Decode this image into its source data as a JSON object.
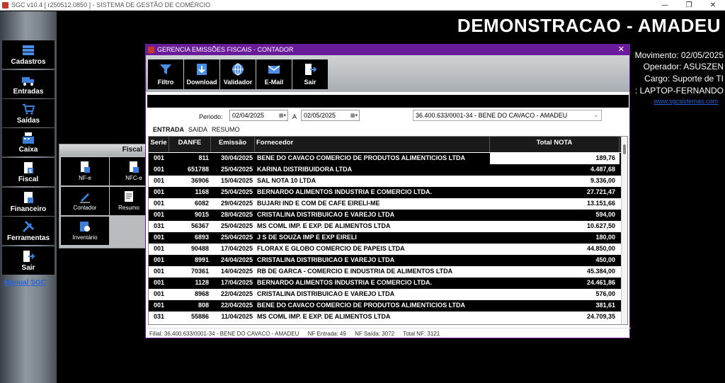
{
  "window": {
    "title": "SGC v10.4 [ r250512.0850 ] - SISTEMA DE GESTÃO DE COMÉRCIO",
    "minimize": "—",
    "maximize": "❐",
    "close": "✕"
  },
  "sidebar": {
    "items": [
      {
        "label": "Cadastros",
        "icon": "stack-icon"
      },
      {
        "label": "Entradas",
        "icon": "truck-icon"
      },
      {
        "label": "Saídas",
        "icon": "cart-icon"
      },
      {
        "label": "Caixa",
        "icon": "cash-register-icon"
      },
      {
        "label": "Fiscal",
        "icon": "fiscal-document-icon"
      },
      {
        "label": "Financeiro",
        "icon": "finance-document-icon"
      },
      {
        "label": "Ferramentas",
        "icon": "tools-icon"
      },
      {
        "label": "Sair",
        "icon": "exit-door-icon"
      }
    ],
    "manual_link": "Manual SGC"
  },
  "header": {
    "title": "DEMONSTRACAO - AMADEU",
    "movimento": "Movimento: 02/05/2025",
    "operador": "Operador: ASUSZEN",
    "cargo": "Cargo: Suporte de TI",
    "maquina": ": LAPTOP-FERNANDO",
    "site": "www.sgcsistemas.com"
  },
  "fiscal_panel": {
    "title": "Fiscal",
    "buttons": [
      {
        "label": "NF-e"
      },
      {
        "label": "NFC-e"
      },
      {
        "label": "Contador"
      },
      {
        "label": "Resumo"
      },
      {
        "label": "Inventário"
      }
    ]
  },
  "dialog": {
    "title": "GERENCIA EMISSÕES FISCAIS - CONTADOR",
    "close": "✕",
    "toolbar": {
      "filtro": "Filtro",
      "download": "Download",
      "validador": "Validador",
      "email": "E-Mail",
      "sair": "Sair"
    },
    "filters": {
      "periodo_label": "Periodo:",
      "date_from": "02/04/2025",
      "separator": "A",
      "date_to": "02/05/2025",
      "company": "36.400.633/0001-34 - BENE DO CAVACO - AMADEU"
    },
    "tabs": [
      "ENTRADA",
      "SAIDA",
      "RESUMO"
    ],
    "grid": {
      "columns": [
        "Serie",
        "DANFE",
        "Emissão",
        "Fornecedor",
        "Total NOTA"
      ],
      "rows": [
        [
          "001",
          "811",
          "30/04/2025",
          "BENE DO CAVACO COMERCIO DE PRODUTOS ALIMENTICIOS LTDA",
          "189,76"
        ],
        [
          "001",
          "651788",
          "25/04/2025",
          "KARINA DISTRIBUIDORA LTDA",
          "4.487,68"
        ],
        [
          "001",
          "36906",
          "15/04/2025",
          "SAL NOTA 10 LTDA",
          "9.336,00"
        ],
        [
          "001",
          "1168",
          "25/04/2025",
          "BERNARDO ALIMENTOS INDUSTRIA E COMERCIO LTDA.",
          "27.721,47"
        ],
        [
          "001",
          "6082",
          "29/04/2025",
          "BUJARI IND E COM DE CAFE EIRELI-ME",
          "13.151,66"
        ],
        [
          "001",
          "9015",
          "28/04/2025",
          "CRISTALINA DISTRIBUICAO E VAREJO LTDA",
          "594,00"
        ],
        [
          "031",
          "56367",
          "25/04/2025",
          "MS COML IMP. E EXP. DE ALIMENTOS LTDA",
          "10.627,50"
        ],
        [
          "001",
          "6893",
          "25/04/2025",
          "J S DE SOUZA IMP E EXP EIRELI",
          "180,00"
        ],
        [
          "001",
          "90488",
          "17/04/2025",
          "FLORAX E GLOBO COMERCIO DE PAPEIS LTDA",
          "44.850,00"
        ],
        [
          "001",
          "8991",
          "24/04/2025",
          "CRISTALINA DISTRIBUICAO E VAREJO LTDA",
          "450,00"
        ],
        [
          "001",
          "70361",
          "14/04/2025",
          "RB DE GARCA - COMERCIO E INDUSTRIA DE ALIMENTOS LTDA",
          "45.384,00"
        ],
        [
          "001",
          "1128",
          "17/04/2025",
          "BERNARDO ALIMENTOS INDUSTRIA E COMERCIO LTDA.",
          "24.461,86"
        ],
        [
          "001",
          "8968",
          "22/04/2025",
          "CRISTALINA DISTRIBUICAO E VAREJO LTDA",
          "576,00"
        ],
        [
          "001",
          "808",
          "22/04/2025",
          "BENE DO CAVACO COMERCIO DE PRODUTOS ALIMENTICIOS LTDA",
          "381,61"
        ],
        [
          "031",
          "55886",
          "11/04/2025",
          "MS COML IMP. E EXP. DE ALIMENTOS LTDA",
          "24.709,35"
        ]
      ]
    },
    "status": {
      "filial": "Filial: 36.400.633/0001-34 - BENE DO CAVACO - AMADEU",
      "nf_entrada": "NF Entrada: 49",
      "nf_saida": "NF Saída: 3072",
      "total_nf": "Total NF: 3121"
    }
  }
}
